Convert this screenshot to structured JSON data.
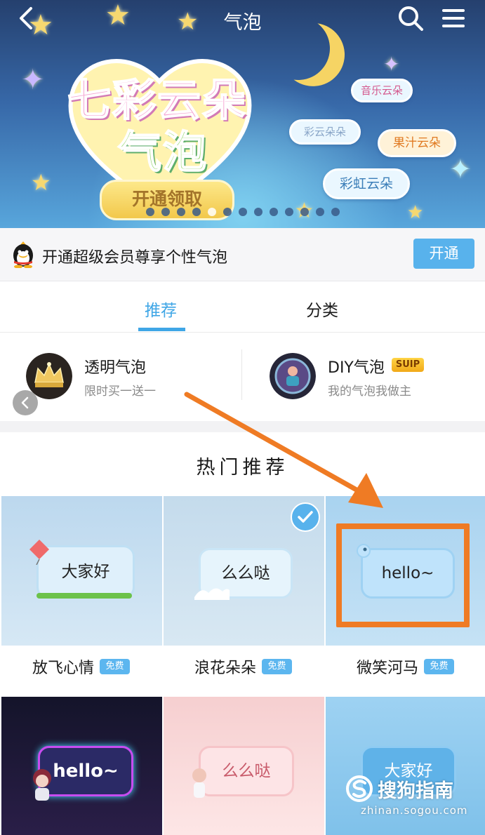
{
  "header": {
    "title": "气泡",
    "back_icon": "chevron-left-icon",
    "search_icon": "search-icon",
    "menu_icon": "menu-icon"
  },
  "banner": {
    "headline_line1": "七彩云朵",
    "headline_line2": "气泡",
    "cta": "开通领取",
    "tags": [
      "音乐云朵",
      "彩云朵朵",
      "果汁云朵",
      "彩虹云朵"
    ],
    "slide_count": 13,
    "active_slide": 4
  },
  "vip_bar": {
    "text": "开通超级会员尊享个性气泡",
    "button": "开通"
  },
  "tabs": [
    {
      "label": "推荐",
      "active": true
    },
    {
      "label": "分类",
      "active": false
    }
  ],
  "featured": [
    {
      "title": "透明气泡",
      "subtitle": "限时买一送一"
    },
    {
      "title": "DIY气泡",
      "subtitle": "我的气泡我做主",
      "badge": "SUIP"
    }
  ],
  "hot": {
    "title": "热门推荐",
    "items": [
      {
        "preview_text": "大家好",
        "name": "放飞心情",
        "badge": "免费"
      },
      {
        "preview_text": "么么哒",
        "name": "浪花朵朵",
        "badge": "免费",
        "selected": true
      },
      {
        "preview_text": "hello~",
        "name": "微笑河马",
        "badge": "免费"
      },
      {
        "preview_text": "hello~"
      },
      {
        "preview_text": "么么哒"
      },
      {
        "preview_text": "大家好"
      }
    ]
  },
  "watermark": {
    "text": "搜狗指南",
    "url_text": "zhinan.sogou.com"
  },
  "colors": {
    "accent": "#3fa6e6",
    "button": "#58b2ec",
    "annotation": "#ef7b24"
  }
}
